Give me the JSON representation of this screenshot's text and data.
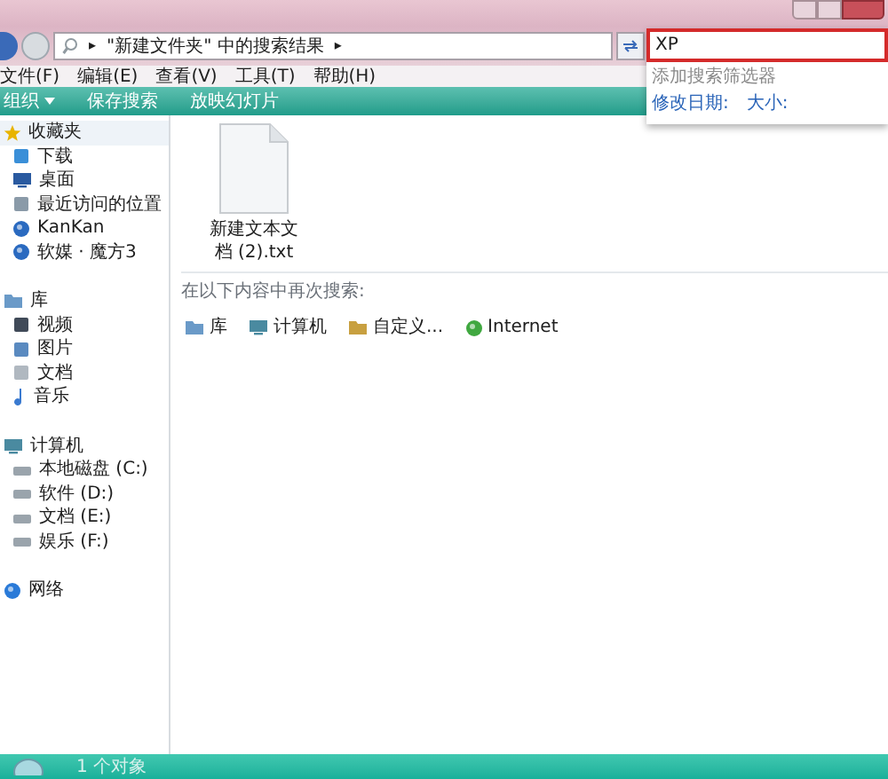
{
  "address": {
    "path": "\"新建文件夹\" 中的搜索结果",
    "arrow": "▸"
  },
  "search": {
    "value": "XP",
    "suggest_header": "添加搜索筛选器",
    "filters": [
      "修改日期:",
      "大小:"
    ]
  },
  "menu": [
    "文件(F)",
    "编辑(E)",
    "查看(V)",
    "工具(T)",
    "帮助(H)"
  ],
  "toolbar": [
    {
      "label": "组织",
      "dropdown": true
    },
    {
      "label": "保存搜索",
      "dropdown": false
    },
    {
      "label": "放映幻灯片",
      "dropdown": false
    }
  ],
  "sidebar": [
    {
      "label": "收藏夹",
      "kind": "star",
      "selected": true,
      "children": [
        {
          "label": "下载",
          "kind": "download",
          "selected": false
        },
        {
          "label": "桌面",
          "kind": "desktop",
          "selected": false
        },
        {
          "label": "最近访问的位置",
          "kind": "recent",
          "selected": false
        },
        {
          "label": "KanKan",
          "kind": "globe",
          "selected": false
        },
        {
          "label": "软媒 · 魔方3",
          "kind": "globe",
          "selected": false
        }
      ]
    },
    {
      "label": "库",
      "kind": "library",
      "selected": false,
      "children": [
        {
          "label": "视频",
          "kind": "video",
          "selected": false
        },
        {
          "label": "图片",
          "kind": "picture",
          "selected": false
        },
        {
          "label": "文档",
          "kind": "doc",
          "selected": false
        },
        {
          "label": "音乐",
          "kind": "music",
          "selected": false
        }
      ]
    },
    {
      "label": "计算机",
      "kind": "computer",
      "selected": false,
      "children": [
        {
          "label": "本地磁盘 (C:)",
          "kind": "drive",
          "selected": false
        },
        {
          "label": "软件 (D:)",
          "kind": "drive",
          "selected": false
        },
        {
          "label": "文档 (E:)",
          "kind": "drive",
          "selected": false
        },
        {
          "label": "娱乐 (F:)",
          "kind": "drive",
          "selected": false
        }
      ]
    },
    {
      "label": "网络",
      "kind": "network",
      "selected": false
    }
  ],
  "files": [
    {
      "name": "新建文本文档 (2).txt"
    }
  ],
  "search_again": {
    "label": "在以下内容中再次搜索:",
    "targets": [
      {
        "label": "库",
        "kind": "library"
      },
      {
        "label": "计算机",
        "kind": "computer"
      },
      {
        "label": "自定义...",
        "kind": "folder"
      },
      {
        "label": "Internet",
        "kind": "internet"
      }
    ]
  },
  "status_bar": {
    "text": "1 个对象"
  }
}
